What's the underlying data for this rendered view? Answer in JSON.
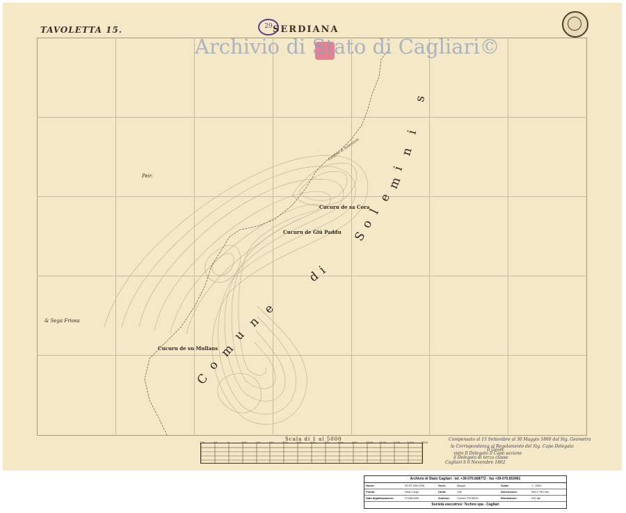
{
  "map": {
    "sheet_title": "TAVOLETTA 15.",
    "comune_title": "SERDIANA",
    "watermark": "Archivio di Stato di Cagliari©",
    "stamp_number": "29",
    "labels": {
      "periferia": "Peir.",
      "sa_cora": "Cucuru de sa Cora",
      "giu_paddu": "Cucuru de Giù Paddu",
      "su_mullans": "Cucuru de su Mullans",
      "regione": "& Sega Friosa"
    },
    "border_label": "Confine di Soleminis",
    "comune_letters": [
      "C",
      "o",
      "m",
      "u",
      "n",
      "e",
      "d",
      "i",
      "S",
      "o",
      "l",
      "e",
      "m",
      "i",
      "n",
      "i",
      "s"
    ],
    "scale_title": "Scala di 1 al 5000",
    "scale_ticks": [
      "100",
      "50",
      "0",
      "100",
      "200",
      "300",
      "400",
      "500",
      "600",
      "700",
      "800",
      "900",
      "1000",
      "1100",
      "1200",
      "1300",
      "1400"
    ],
    "signature_lines": [
      "Compensato al 15 Settembre al 30 Maggio 1860 dal Sig. Geometra",
      "la Corrispondenza al Regolamento del Sig. Capo Delegato",
      "Il Geom.",
      "visto Il Delegato Il Capo sezione",
      "il Delegato di terza classe",
      "Cagliari li 6 Novembre 1862"
    ]
  },
  "info_table": {
    "header": "Archivio di Stato Cagliari - tel. +39-070.668772 - fax +39-070.653401",
    "rows": [
      [
        {
          "k": "Nome:",
          "v": "RCST-298 (TM)"
        },
        {
          "k": "Serie:",
          "v": "Mappe"
        },
        {
          "k": "Scala:",
          "v": "1 : 5000"
        }
      ],
      [
        {
          "k": "Fondo:",
          "v": "Real Corpo"
        },
        {
          "k": "Unità:",
          "v": "298"
        },
        {
          "k": "Dimensione:",
          "v": "950 x 780 mm"
        }
      ],
      [
        {
          "k": "Data digitalizzazione:",
          "v": "27/08/1999"
        },
        {
          "k": "Scanner:",
          "v": "Contex FSC8010"
        },
        {
          "k": "Risoluzione:",
          "v": "200 dpi"
        }
      ]
    ],
    "footer": "Società esecutrice: Techno spa - Cagliari"
  },
  "colors": {
    "paper": "#f5e8c6",
    "ink": "#2f2a24",
    "watermark": "#8ca0be",
    "stamp_purple": "#5c3a8c",
    "stamp_pink": "#e0778d"
  }
}
